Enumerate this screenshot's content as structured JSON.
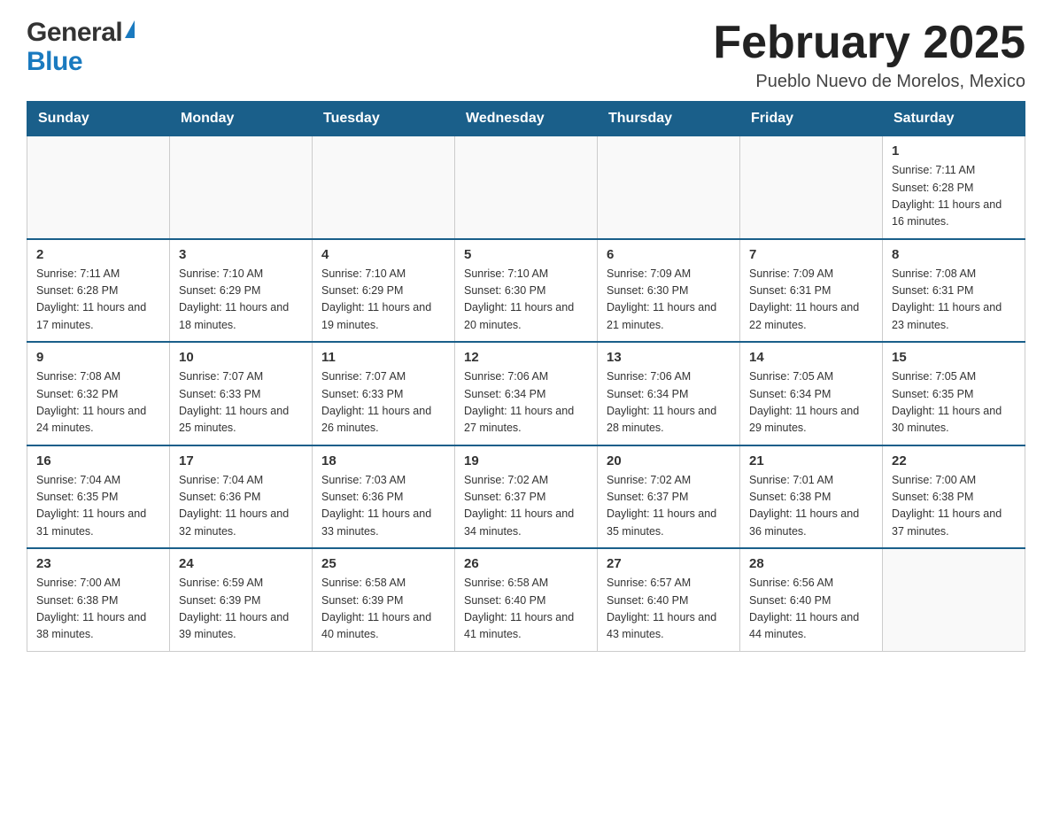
{
  "header": {
    "logo_general": "General",
    "logo_blue": "Blue",
    "title": "February 2025",
    "subtitle": "Pueblo Nuevo de Morelos, Mexico"
  },
  "days_of_week": [
    "Sunday",
    "Monday",
    "Tuesday",
    "Wednesday",
    "Thursday",
    "Friday",
    "Saturday"
  ],
  "weeks": [
    {
      "days": [
        {
          "number": "",
          "info": ""
        },
        {
          "number": "",
          "info": ""
        },
        {
          "number": "",
          "info": ""
        },
        {
          "number": "",
          "info": ""
        },
        {
          "number": "",
          "info": ""
        },
        {
          "number": "",
          "info": ""
        },
        {
          "number": "1",
          "info": "Sunrise: 7:11 AM\nSunset: 6:28 PM\nDaylight: 11 hours and 16 minutes."
        }
      ]
    },
    {
      "days": [
        {
          "number": "2",
          "info": "Sunrise: 7:11 AM\nSunset: 6:28 PM\nDaylight: 11 hours and 17 minutes."
        },
        {
          "number": "3",
          "info": "Sunrise: 7:10 AM\nSunset: 6:29 PM\nDaylight: 11 hours and 18 minutes."
        },
        {
          "number": "4",
          "info": "Sunrise: 7:10 AM\nSunset: 6:29 PM\nDaylight: 11 hours and 19 minutes."
        },
        {
          "number": "5",
          "info": "Sunrise: 7:10 AM\nSunset: 6:30 PM\nDaylight: 11 hours and 20 minutes."
        },
        {
          "number": "6",
          "info": "Sunrise: 7:09 AM\nSunset: 6:30 PM\nDaylight: 11 hours and 21 minutes."
        },
        {
          "number": "7",
          "info": "Sunrise: 7:09 AM\nSunset: 6:31 PM\nDaylight: 11 hours and 22 minutes."
        },
        {
          "number": "8",
          "info": "Sunrise: 7:08 AM\nSunset: 6:31 PM\nDaylight: 11 hours and 23 minutes."
        }
      ]
    },
    {
      "days": [
        {
          "number": "9",
          "info": "Sunrise: 7:08 AM\nSunset: 6:32 PM\nDaylight: 11 hours and 24 minutes."
        },
        {
          "number": "10",
          "info": "Sunrise: 7:07 AM\nSunset: 6:33 PM\nDaylight: 11 hours and 25 minutes."
        },
        {
          "number": "11",
          "info": "Sunrise: 7:07 AM\nSunset: 6:33 PM\nDaylight: 11 hours and 26 minutes."
        },
        {
          "number": "12",
          "info": "Sunrise: 7:06 AM\nSunset: 6:34 PM\nDaylight: 11 hours and 27 minutes."
        },
        {
          "number": "13",
          "info": "Sunrise: 7:06 AM\nSunset: 6:34 PM\nDaylight: 11 hours and 28 minutes."
        },
        {
          "number": "14",
          "info": "Sunrise: 7:05 AM\nSunset: 6:34 PM\nDaylight: 11 hours and 29 minutes."
        },
        {
          "number": "15",
          "info": "Sunrise: 7:05 AM\nSunset: 6:35 PM\nDaylight: 11 hours and 30 minutes."
        }
      ]
    },
    {
      "days": [
        {
          "number": "16",
          "info": "Sunrise: 7:04 AM\nSunset: 6:35 PM\nDaylight: 11 hours and 31 minutes."
        },
        {
          "number": "17",
          "info": "Sunrise: 7:04 AM\nSunset: 6:36 PM\nDaylight: 11 hours and 32 minutes."
        },
        {
          "number": "18",
          "info": "Sunrise: 7:03 AM\nSunset: 6:36 PM\nDaylight: 11 hours and 33 minutes."
        },
        {
          "number": "19",
          "info": "Sunrise: 7:02 AM\nSunset: 6:37 PM\nDaylight: 11 hours and 34 minutes."
        },
        {
          "number": "20",
          "info": "Sunrise: 7:02 AM\nSunset: 6:37 PM\nDaylight: 11 hours and 35 minutes."
        },
        {
          "number": "21",
          "info": "Sunrise: 7:01 AM\nSunset: 6:38 PM\nDaylight: 11 hours and 36 minutes."
        },
        {
          "number": "22",
          "info": "Sunrise: 7:00 AM\nSunset: 6:38 PM\nDaylight: 11 hours and 37 minutes."
        }
      ]
    },
    {
      "days": [
        {
          "number": "23",
          "info": "Sunrise: 7:00 AM\nSunset: 6:38 PM\nDaylight: 11 hours and 38 minutes."
        },
        {
          "number": "24",
          "info": "Sunrise: 6:59 AM\nSunset: 6:39 PM\nDaylight: 11 hours and 39 minutes."
        },
        {
          "number": "25",
          "info": "Sunrise: 6:58 AM\nSunset: 6:39 PM\nDaylight: 11 hours and 40 minutes."
        },
        {
          "number": "26",
          "info": "Sunrise: 6:58 AM\nSunset: 6:40 PM\nDaylight: 11 hours and 41 minutes."
        },
        {
          "number": "27",
          "info": "Sunrise: 6:57 AM\nSunset: 6:40 PM\nDaylight: 11 hours and 43 minutes."
        },
        {
          "number": "28",
          "info": "Sunrise: 6:56 AM\nSunset: 6:40 PM\nDaylight: 11 hours and 44 minutes."
        },
        {
          "number": "",
          "info": ""
        }
      ]
    }
  ]
}
